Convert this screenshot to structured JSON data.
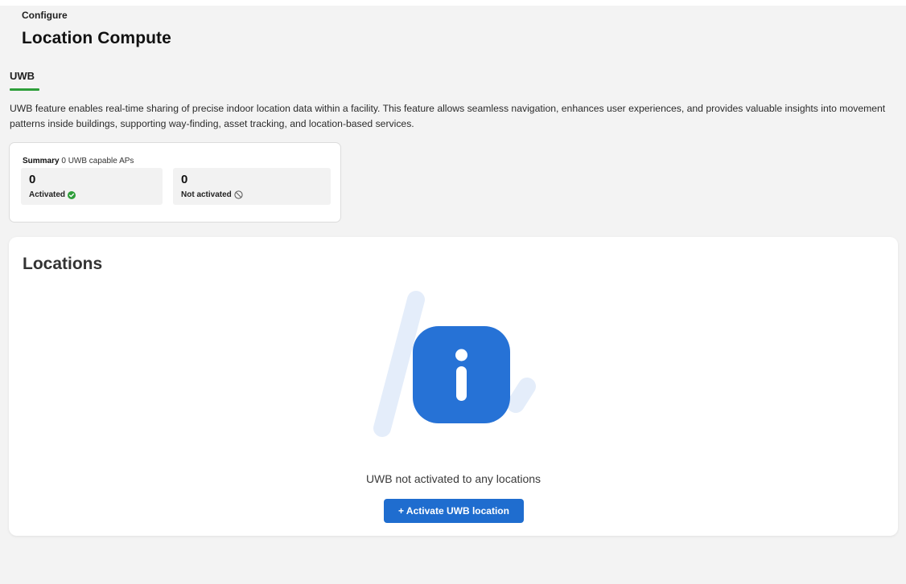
{
  "header": {
    "breadcrumb": "Configure",
    "title": "Location Compute"
  },
  "tabs": [
    {
      "label": "UWB",
      "active": true
    }
  ],
  "description": "UWB feature enables real-time sharing of precise indoor location data within a facility. This feature allows seamless navigation, enhances user experiences, and provides valuable insights into movement patterns inside buildings, supporting way-finding, asset tracking, and location-based services.",
  "summary": {
    "heading": "Summary",
    "subheading": "0 UWB capable APs",
    "activated": {
      "value": "0",
      "label": "Activated",
      "icon": "check-circle-icon"
    },
    "not_activated": {
      "value": "0",
      "label": "Not activated",
      "icon": "prohibited-icon"
    }
  },
  "locations": {
    "title": "Locations",
    "empty_text": "UWB not activated to any locations",
    "button_label": "+ Activate UWB location",
    "illustration_icon": "info-icon"
  },
  "colors": {
    "accent_green": "#2e9e3a",
    "primary_blue": "#1f6dcf",
    "background": "#f3f3f3"
  }
}
